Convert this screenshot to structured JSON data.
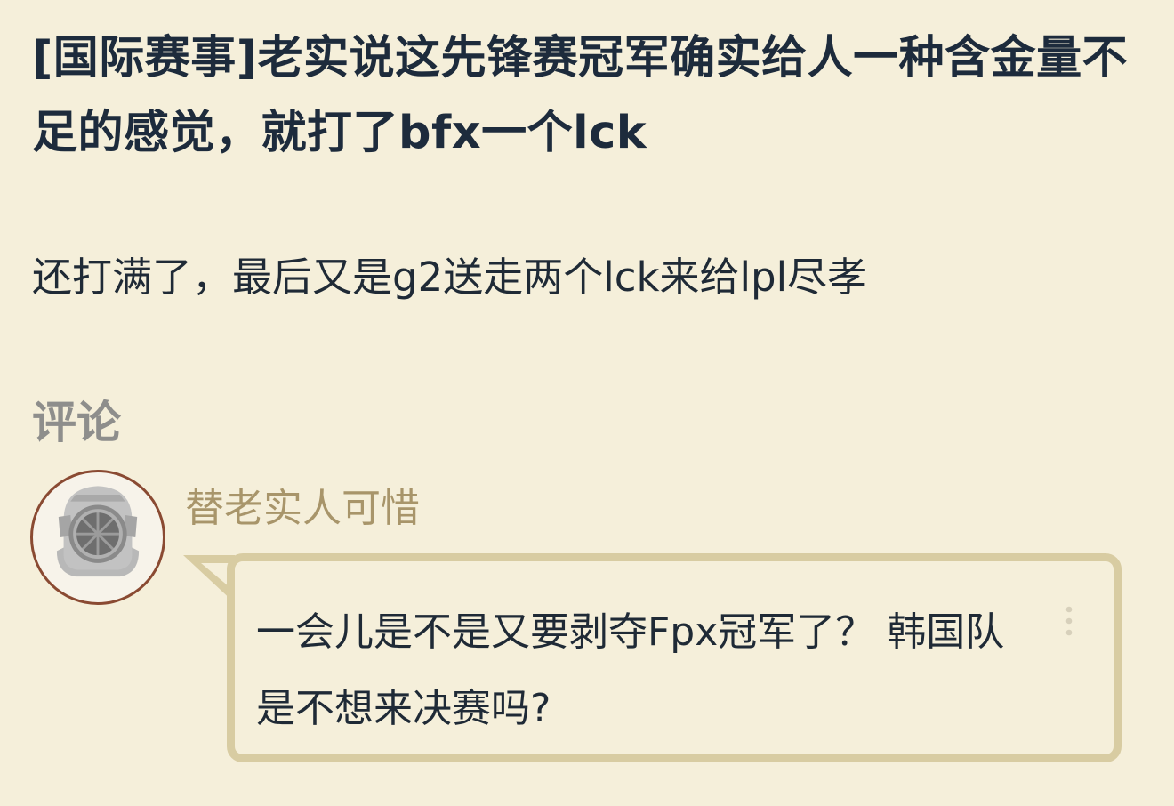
{
  "post": {
    "title": "[国际赛事]老实说这先锋赛冠军确实给人一种含金量不足的感觉，就打了bfx一个lck",
    "body": "还打满了，最后又是g2送走两个lck来给lpl尽孝"
  },
  "comments": {
    "heading": "评论",
    "items": [
      {
        "author": "替老实人可惜",
        "avatar_icon": "diving-helmet-icon",
        "text": "一会儿是不是又要剥夺Fpx冠军了？ 韩国队是不想来决赛吗?",
        "menu_icon": "more-vertical-icon"
      }
    ]
  },
  "colors": {
    "background": "#f5efda",
    "title": "#1d2b3c",
    "heading": "#8e8e8c",
    "author": "#a8956a",
    "bubble_border": "#d8cca2",
    "avatar_border": "#8a4a32"
  }
}
